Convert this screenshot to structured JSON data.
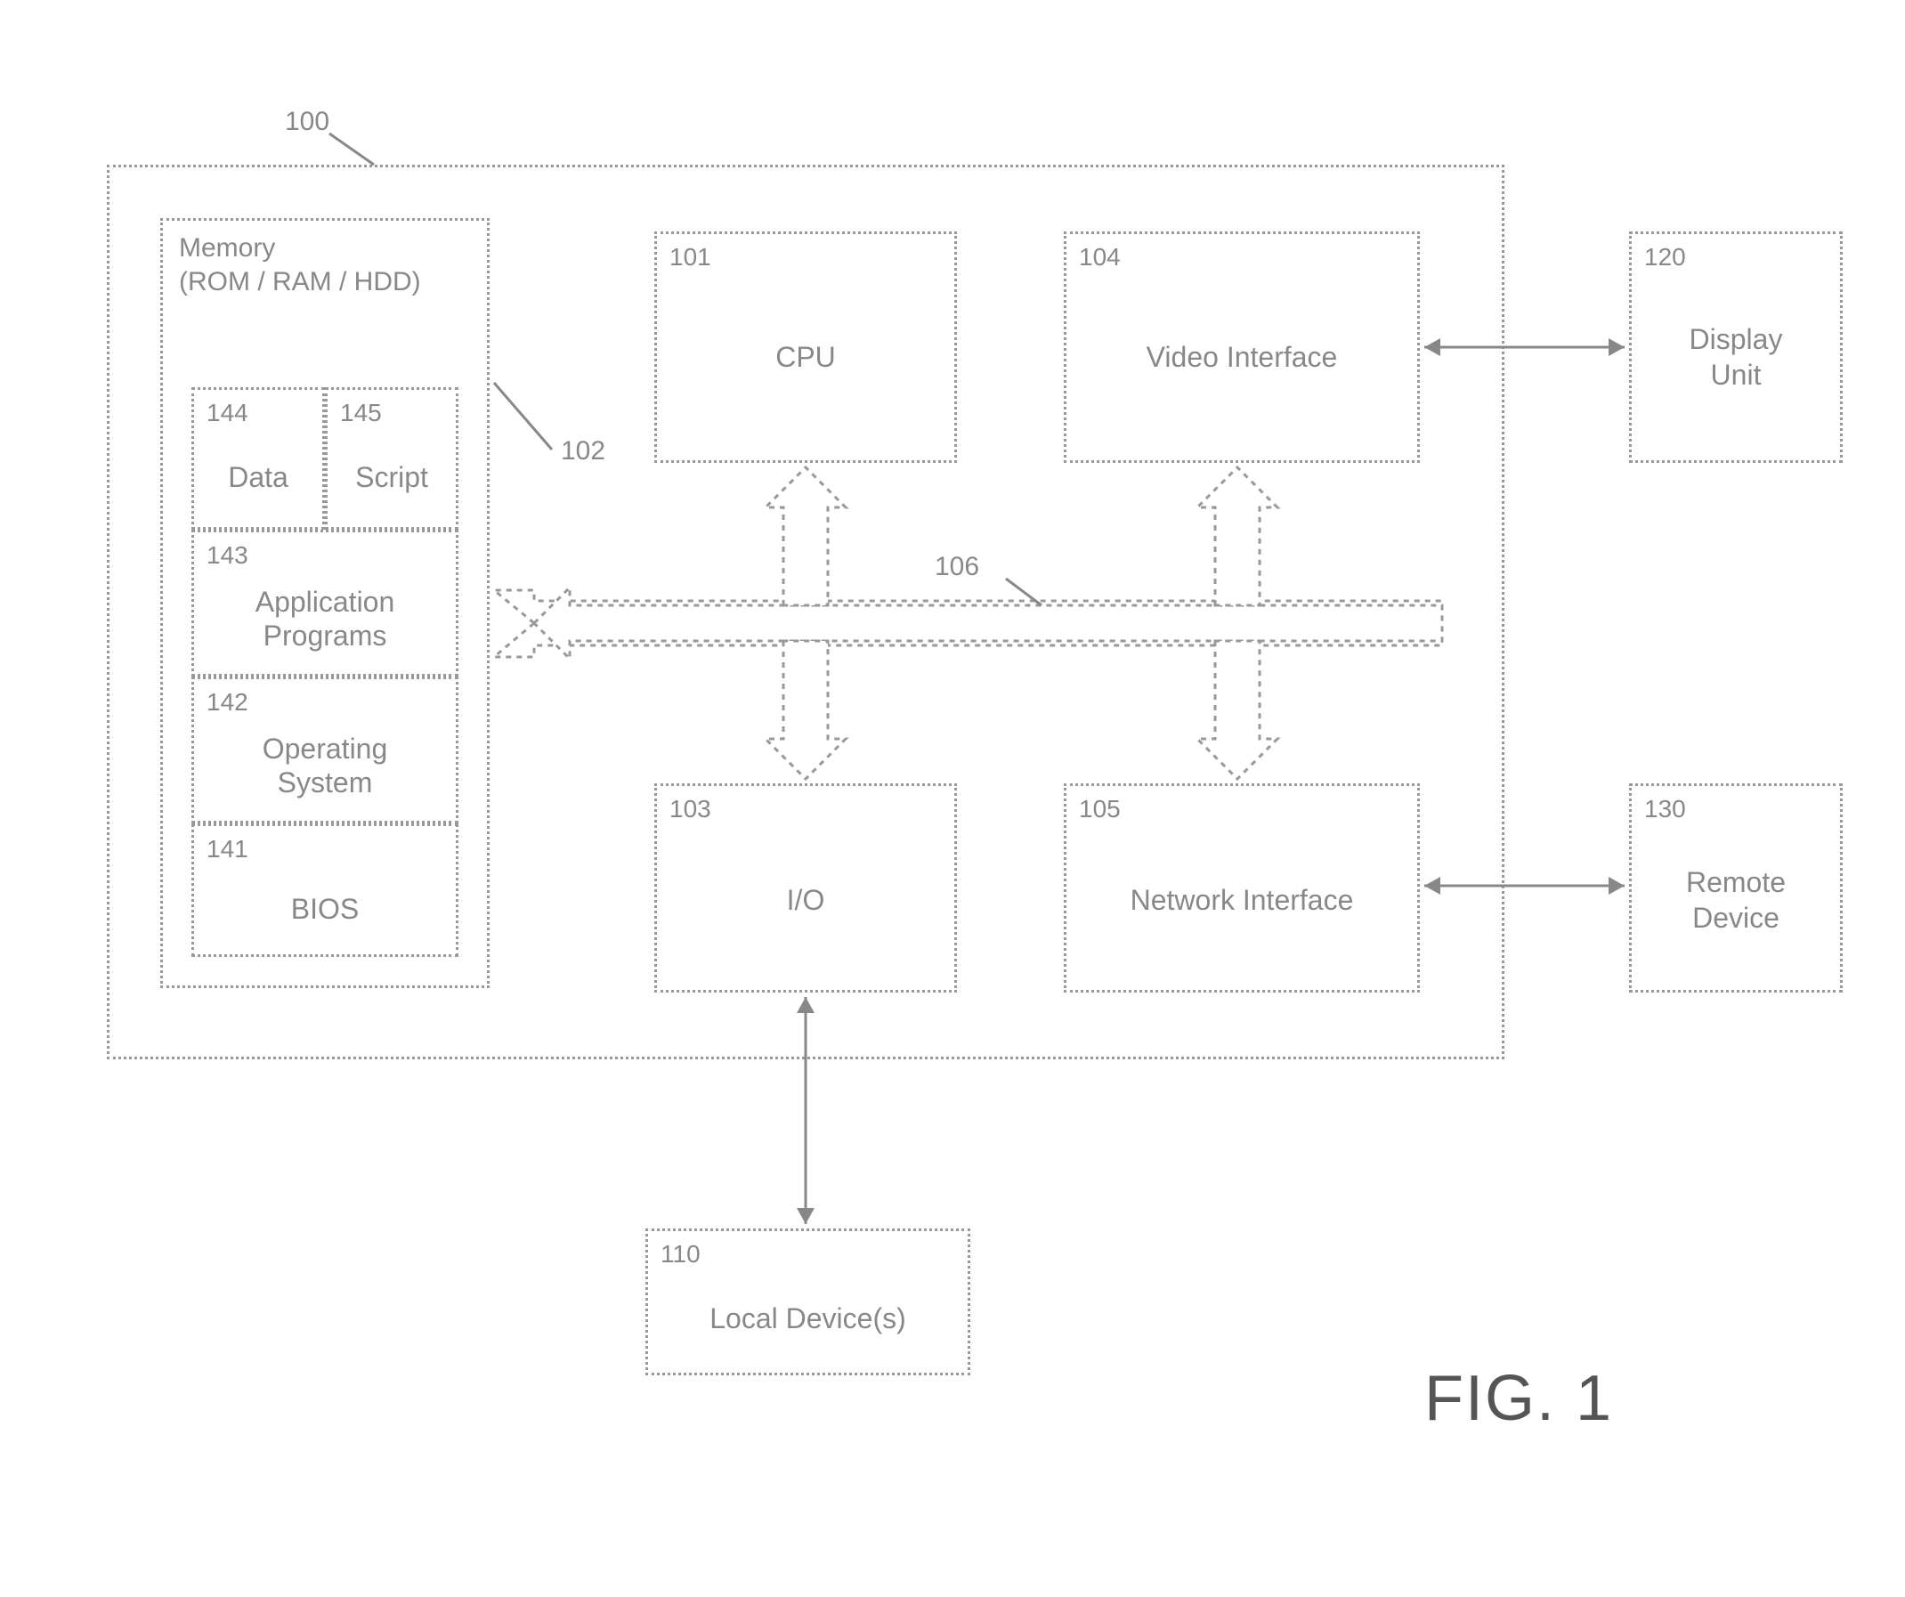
{
  "figure_caption": "FIG. 1",
  "system": {
    "ref": "100",
    "memory": {
      "ref": "102",
      "title1": "Memory",
      "title2": "(ROM / RAM / HDD)",
      "data": {
        "ref": "144",
        "label": "Data"
      },
      "script": {
        "ref": "145",
        "label": "Script"
      },
      "apps": {
        "ref": "143",
        "label1": "Application",
        "label2": "Programs"
      },
      "os": {
        "ref": "142",
        "label1": "Operating",
        "label2": "System"
      },
      "bios": {
        "ref": "141",
        "label": "BIOS"
      }
    },
    "cpu": {
      "ref": "101",
      "label": "CPU"
    },
    "io": {
      "ref": "103",
      "label": "I/O"
    },
    "video": {
      "ref": "104",
      "label": "Video Interface"
    },
    "network": {
      "ref": "105",
      "label": "Network Interface"
    },
    "bus": {
      "ref": "106"
    }
  },
  "local_devices": {
    "ref": "110",
    "label": "Local Device(s)"
  },
  "display": {
    "ref": "120",
    "label1": "Display",
    "label2": "Unit"
  },
  "remote": {
    "ref": "130",
    "label1": "Remote",
    "label2": "Device"
  }
}
